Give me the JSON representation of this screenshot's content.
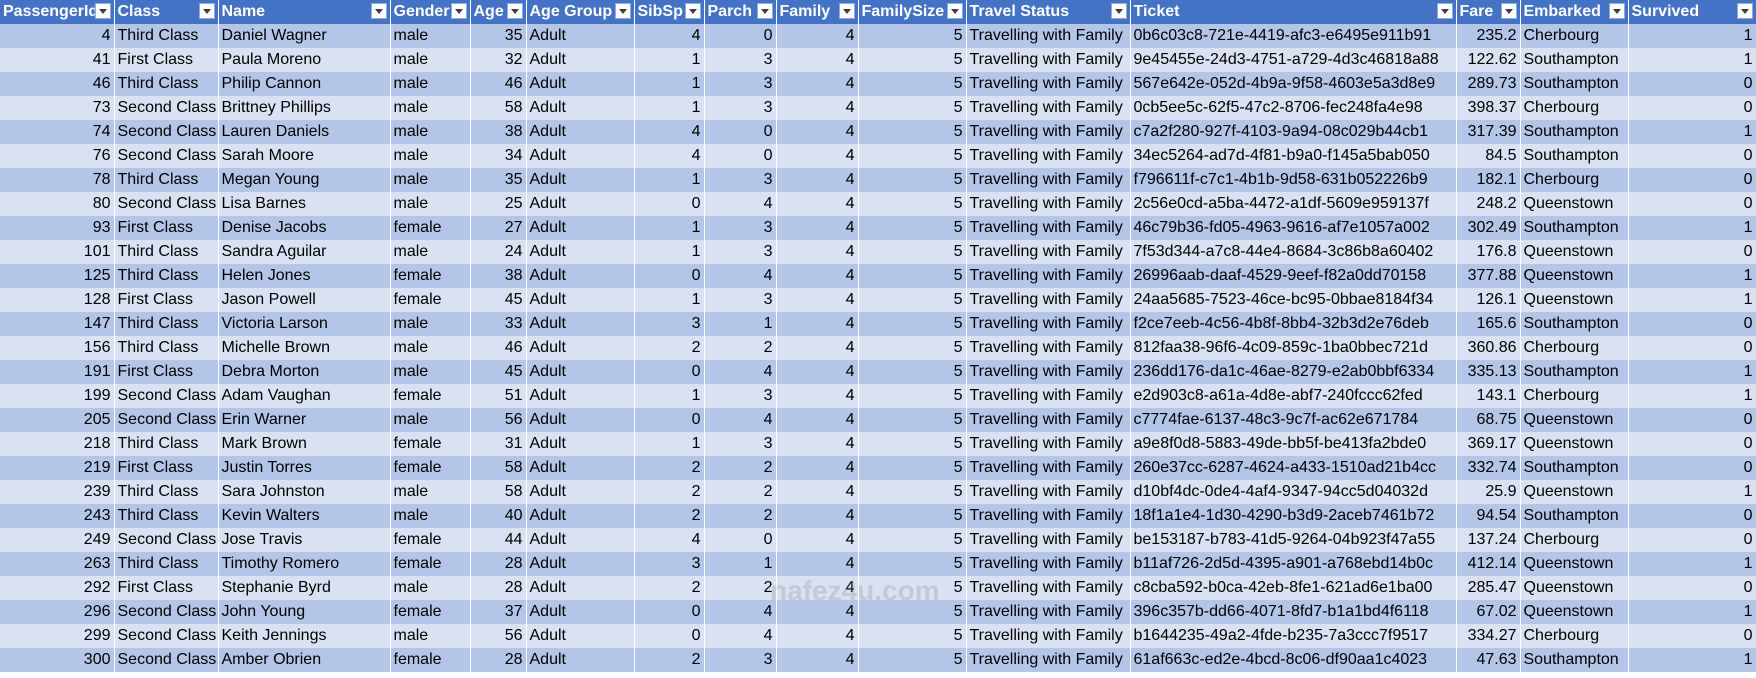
{
  "colors": {
    "header_bg": "#4472c4",
    "row_dark": "#b4c6e7",
    "row_light": "#d9e1f2",
    "header_text": "#ffffff"
  },
  "columns": [
    {
      "label": "PassengerId",
      "align": "num"
    },
    {
      "label": "Class",
      "align": "txt"
    },
    {
      "label": "Name",
      "align": "txt"
    },
    {
      "label": "Gender",
      "align": "txt"
    },
    {
      "label": "Age",
      "align": "num"
    },
    {
      "label": "Age Group",
      "align": "txt"
    },
    {
      "label": "SibSp",
      "align": "num"
    },
    {
      "label": "Parch",
      "align": "num"
    },
    {
      "label": "Family",
      "align": "num"
    },
    {
      "label": "FamilySize",
      "align": "num"
    },
    {
      "label": "Travel Status",
      "align": "txt"
    },
    {
      "label": "Ticket",
      "align": "txt"
    },
    {
      "label": "Fare",
      "align": "num"
    },
    {
      "label": "Embarked",
      "align": "txt"
    },
    {
      "label": "Survived",
      "align": "num"
    }
  ],
  "rows": [
    [
      "4",
      "Third Class",
      "Daniel Wagner",
      "male",
      "35",
      "Adult",
      "4",
      "0",
      "4",
      "5",
      "Travelling with Family",
      "0b6c03c8-721e-4419-afc3-e6495e911b91",
      "235.2",
      "Cherbourg",
      "1"
    ],
    [
      "41",
      "First Class",
      "Paula Moreno",
      "male",
      "32",
      "Adult",
      "1",
      "3",
      "4",
      "5",
      "Travelling with Family",
      "9e45455e-24d3-4751-a729-4d3c46818a88",
      "122.62",
      "Southampton",
      "1"
    ],
    [
      "46",
      "Third Class",
      "Philip Cannon",
      "male",
      "46",
      "Adult",
      "1",
      "3",
      "4",
      "5",
      "Travelling with Family",
      "567e642e-052d-4b9a-9f58-4603e5a3d8e9",
      "289.73",
      "Southampton",
      "0"
    ],
    [
      "73",
      "Second Class",
      "Brittney Phillips",
      "male",
      "58",
      "Adult",
      "1",
      "3",
      "4",
      "5",
      "Travelling with Family",
      "0cb5ee5c-62f5-47c2-8706-fec248fa4e98",
      "398.37",
      "Cherbourg",
      "0"
    ],
    [
      "74",
      "Second Class",
      "Lauren Daniels",
      "male",
      "38",
      "Adult",
      "4",
      "0",
      "4",
      "5",
      "Travelling with Family",
      "c7a2f280-927f-4103-9a94-08c029b44cb1",
      "317.39",
      "Southampton",
      "1"
    ],
    [
      "76",
      "Second Class",
      "Sarah Moore",
      "male",
      "34",
      "Adult",
      "4",
      "0",
      "4",
      "5",
      "Travelling with Family",
      "34ec5264-ad7d-4f81-b9a0-f145a5bab050",
      "84.5",
      "Southampton",
      "0"
    ],
    [
      "78",
      "Third Class",
      "Megan Young",
      "male",
      "35",
      "Adult",
      "1",
      "3",
      "4",
      "5",
      "Travelling with Family",
      "f796611f-c7c1-4b1b-9d58-631b052226b9",
      "182.1",
      "Cherbourg",
      "0"
    ],
    [
      "80",
      "Second Class",
      "Lisa Barnes",
      "male",
      "25",
      "Adult",
      "0",
      "4",
      "4",
      "5",
      "Travelling with Family",
      "2c56e0cd-a5ba-4472-a1df-5609e959137f",
      "248.2",
      "Queenstown",
      "0"
    ],
    [
      "93",
      "First Class",
      "Denise Jacobs",
      "female",
      "27",
      "Adult",
      "1",
      "3",
      "4",
      "5",
      "Travelling with Family",
      "46c79b36-fd05-4963-9616-af7e1057a002",
      "302.49",
      "Southampton",
      "1"
    ],
    [
      "101",
      "Third Class",
      "Sandra Aguilar",
      "male",
      "24",
      "Adult",
      "1",
      "3",
      "4",
      "5",
      "Travelling with Family",
      "7f53d344-a7c8-44e4-8684-3c86b8a60402",
      "176.8",
      "Queenstown",
      "0"
    ],
    [
      "125",
      "Third Class",
      "Helen Jones",
      "female",
      "38",
      "Adult",
      "0",
      "4",
      "4",
      "5",
      "Travelling with Family",
      "26996aab-daaf-4529-9eef-f82a0dd70158",
      "377.88",
      "Queenstown",
      "1"
    ],
    [
      "128",
      "First Class",
      "Jason Powell",
      "female",
      "45",
      "Adult",
      "1",
      "3",
      "4",
      "5",
      "Travelling with Family",
      "24aa5685-7523-46ce-bc95-0bbae8184f34",
      "126.1",
      "Queenstown",
      "1"
    ],
    [
      "147",
      "Third Class",
      "Victoria Larson",
      "male",
      "33",
      "Adult",
      "3",
      "1",
      "4",
      "5",
      "Travelling with Family",
      "f2ce7eeb-4c56-4b8f-8bb4-32b3d2e76deb",
      "165.6",
      "Southampton",
      "0"
    ],
    [
      "156",
      "Third Class",
      "Michelle Brown",
      "male",
      "46",
      "Adult",
      "2",
      "2",
      "4",
      "5",
      "Travelling with Family",
      "812faa38-96f6-4c09-859c-1ba0bbec721d",
      "360.86",
      "Cherbourg",
      "0"
    ],
    [
      "191",
      "First Class",
      "Debra Morton",
      "male",
      "45",
      "Adult",
      "0",
      "4",
      "4",
      "5",
      "Travelling with Family",
      "236dd176-da1c-46ae-8279-e2ab0bbf6334",
      "335.13",
      "Southampton",
      "1"
    ],
    [
      "199",
      "Second Class",
      "Adam Vaughan",
      "female",
      "51",
      "Adult",
      "1",
      "3",
      "4",
      "5",
      "Travelling with Family",
      "e2d903c8-a61a-4d8e-abf7-240fccc62fed",
      "143.1",
      "Cherbourg",
      "1"
    ],
    [
      "205",
      "Second Class",
      "Erin Warner",
      "male",
      "56",
      "Adult",
      "0",
      "4",
      "4",
      "5",
      "Travelling with Family",
      "c7774fae-6137-48c3-9c7f-ac62e671784",
      "68.75",
      "Queenstown",
      "0"
    ],
    [
      "218",
      "Third Class",
      "Mark Brown",
      "female",
      "31",
      "Adult",
      "1",
      "3",
      "4",
      "5",
      "Travelling with Family",
      "a9e8f0d8-5883-49de-bb5f-be413fa2bde0",
      "369.17",
      "Queenstown",
      "0"
    ],
    [
      "219",
      "First Class",
      "Justin Torres",
      "female",
      "58",
      "Adult",
      "2",
      "2",
      "4",
      "5",
      "Travelling with Family",
      "260e37cc-6287-4624-a433-1510ad21b4cc",
      "332.74",
      "Southampton",
      "0"
    ],
    [
      "239",
      "Third Class",
      "Sara Johnston",
      "male",
      "58",
      "Adult",
      "2",
      "2",
      "4",
      "5",
      "Travelling with Family",
      "d10bf4dc-0de4-4af4-9347-94cc5d04032d",
      "25.9",
      "Queenstown",
      "1"
    ],
    [
      "243",
      "Third Class",
      "Kevin Walters",
      "male",
      "40",
      "Adult",
      "2",
      "2",
      "4",
      "5",
      "Travelling with Family",
      "18f1a1e4-1d30-4290-b3d9-2aceb7461b72",
      "94.54",
      "Southampton",
      "0"
    ],
    [
      "249",
      "Second Class",
      "Jose Travis",
      "female",
      "44",
      "Adult",
      "4",
      "0",
      "4",
      "5",
      "Travelling with Family",
      "be153187-b783-41d5-9264-04b923f47a55",
      "137.24",
      "Cherbourg",
      "0"
    ],
    [
      "263",
      "Third Class",
      "Timothy Romero",
      "female",
      "28",
      "Adult",
      "3",
      "1",
      "4",
      "5",
      "Travelling with Family",
      "b11af726-2d5d-4395-a901-a768ebd14b0c",
      "412.14",
      "Queenstown",
      "1"
    ],
    [
      "292",
      "First Class",
      "Stephanie Byrd",
      "male",
      "28",
      "Adult",
      "2",
      "2",
      "4",
      "5",
      "Travelling with Family",
      "c8cba592-b0ca-42eb-8fe1-621ad6e1ba00",
      "285.47",
      "Queenstown",
      "0"
    ],
    [
      "296",
      "Second Class",
      "John Young",
      "female",
      "37",
      "Adult",
      "0",
      "4",
      "4",
      "5",
      "Travelling with Family",
      "396c357b-dd66-4071-8fd7-b1a1bd4f6118",
      "67.02",
      "Queenstown",
      "1"
    ],
    [
      "299",
      "Second Class",
      "Keith Jennings",
      "male",
      "56",
      "Adult",
      "0",
      "4",
      "4",
      "5",
      "Travelling with Family",
      "b1644235-49a2-4fde-b235-7a3ccc7f9517",
      "334.27",
      "Cherbourg",
      "0"
    ],
    [
      "300",
      "Second Class",
      "Amber Obrien",
      "female",
      "28",
      "Adult",
      "2",
      "3",
      "4",
      "5",
      "Travelling with Family",
      "61af663c-ed2e-4bcd-8c06-df90aa1c4023",
      "47.63",
      "Southampton",
      "1"
    ]
  ],
  "watermark": "nafez4u.com"
}
